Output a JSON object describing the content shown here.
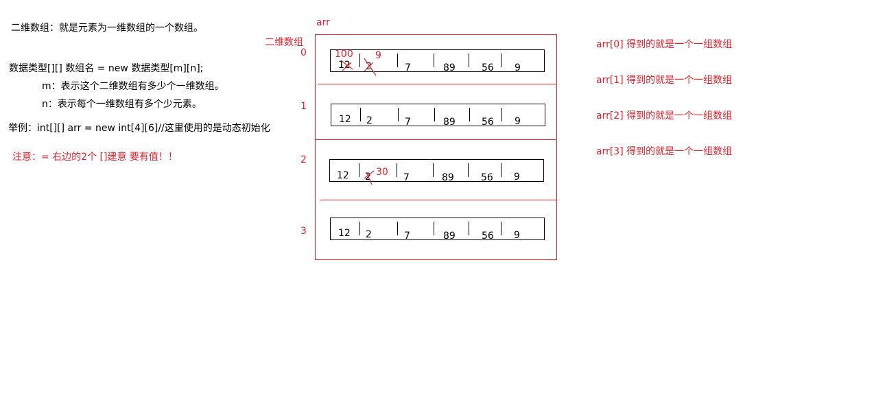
{
  "left": {
    "definition": "二维数组：就是元素为一维数组的一个数组。",
    "syntax": "数据类型[][] 数组名 = new 数据类型[m][n];",
    "m_desc": "m：表示这个二维数组有多少个一维数组。",
    "n_desc": "n：表示每个一维数组有多个少元素。",
    "example": "举例：int[][] arr = new int[4][6]//这里使用的是动态初始化",
    "note": "注意：= 右边的2个 []建意 要有值！！"
  },
  "diagram": {
    "arr_label": "arr",
    "box_label": "二维数组",
    "row_indices": [
      "0",
      "1",
      "2",
      "3"
    ],
    "rows": [
      [
        "12",
        "2",
        "7",
        "89",
        "56",
        "9"
      ],
      [
        "12",
        "2",
        "7",
        "89",
        "56",
        "9"
      ],
      [
        "12",
        "2",
        "7",
        "89",
        "56",
        "9"
      ],
      [
        "12",
        "2",
        "7",
        "89",
        "56",
        "9"
      ]
    ],
    "annotations": {
      "row0_new_first": "100",
      "row0_new_second": "9",
      "row2_new_second": "30"
    }
  },
  "right": {
    "items": [
      "arr[0]  得到的就是一个一组数组",
      "arr[1]  得到的就是一个一组数组",
      "arr[2]  得到的就是一个一组数组",
      "arr[3]  得到的就是一个一组数组"
    ]
  },
  "colors": {
    "red": "#e8202a",
    "black": "#000000"
  }
}
